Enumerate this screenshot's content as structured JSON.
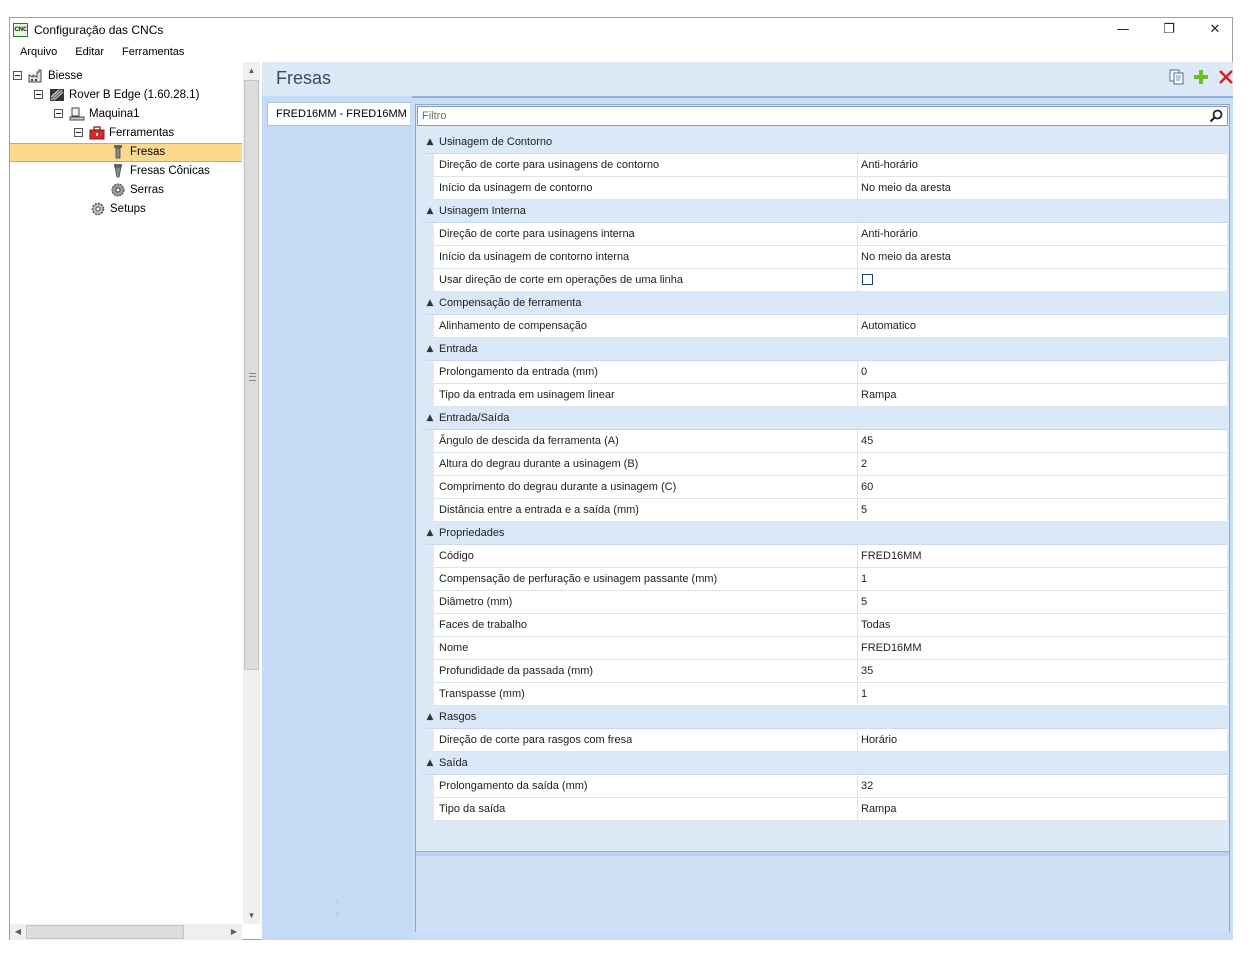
{
  "window": {
    "title": "Configuração das CNCs",
    "app_icon_text": "CNC"
  },
  "window_controls": {
    "minimize": "—",
    "maximize": "❐",
    "close": "✕"
  },
  "menu": [
    "Arquivo",
    "Editar",
    "Ferramentas"
  ],
  "tree": {
    "nodes": [
      {
        "label": "Biesse",
        "icon": "factory-icon"
      },
      {
        "label": "Rover B Edge (1.60.28.1)",
        "icon": "machine-icon"
      },
      {
        "label": "Maquina1",
        "icon": "workstation-icon"
      },
      {
        "label": "Ferramentas",
        "icon": "toolbox-icon"
      },
      {
        "label": "Fresas",
        "icon": "router-bit-icon"
      },
      {
        "label": "Fresas Cônicas",
        "icon": "conical-bit-icon"
      },
      {
        "label": "Serras",
        "icon": "saw-blade-icon"
      },
      {
        "label": "Setups",
        "icon": "gear-icon"
      }
    ],
    "selected": "Fresas"
  },
  "panel": {
    "title": "Fresas",
    "tab_label": "FRED16MM - FRED16MM",
    "filter_placeholder": "Filtro"
  },
  "properties": [
    {
      "category": "Usinagem de Contorno",
      "items": [
        {
          "name": "Direção de corte para usinagens de contorno",
          "value": "Anti-horário"
        },
        {
          "name": "Início da usinagem de contorno",
          "value": "No meio da aresta"
        }
      ]
    },
    {
      "category": "Usinagem Interna",
      "items": [
        {
          "name": "Direção de corte para usinagens interna",
          "value": "Anti-horário"
        },
        {
          "name": "Início da usinagem de contorno interna",
          "value": "No meio da aresta"
        },
        {
          "name": "Usar direção de corte em operações de uma linha",
          "value": "",
          "checkbox": true,
          "checked": false
        }
      ]
    },
    {
      "category": "Compensação de ferramenta",
      "items": [
        {
          "name": "Alinhamento de compensação",
          "value": "Automatico"
        }
      ]
    },
    {
      "category": "Entrada",
      "items": [
        {
          "name": "Prolongamento da entrada (mm)",
          "value": "0"
        },
        {
          "name": "Tipo da entrada em usinagem linear",
          "value": "Rampa"
        }
      ]
    },
    {
      "category": "Entrada/Saída",
      "items": [
        {
          "name": "Ângulo de descida da ferramenta (A)",
          "value": "45"
        },
        {
          "name": "Altura do degrau durante a usinagem (B)",
          "value": "2"
        },
        {
          "name": "Comprimento do degrau durante a usinagem (C)",
          "value": "60"
        },
        {
          "name": "Distância entre a entrada e a saída (mm)",
          "value": "5"
        }
      ]
    },
    {
      "category": "Propriedades",
      "items": [
        {
          "name": "Código",
          "value": "FRED16MM"
        },
        {
          "name": "Compensação de perfuração e usinagem passante (mm)",
          "value": "1"
        },
        {
          "name": "Diâmetro (mm)",
          "value": "5"
        },
        {
          "name": "Faces de trabalho",
          "value": "Todas"
        },
        {
          "name": "Nome",
          "value": "FRED16MM"
        },
        {
          "name": "Profundidade da passada (mm)",
          "value": "35"
        },
        {
          "name": "Transpasse (mm)",
          "value": "1"
        }
      ]
    },
    {
      "category": "Rasgos",
      "items": [
        {
          "name": "Direção de corte para rasgos com fresa",
          "value": "Horário"
        }
      ]
    },
    {
      "category": "Saída",
      "items": [
        {
          "name": "Prolongamento da saída (mm)",
          "value": "32"
        },
        {
          "name": "Tipo da saída",
          "value": "Rampa"
        }
      ]
    }
  ],
  "colors": {
    "accent": "#cfe0f4",
    "selection": "#fcd98c",
    "add": "#6cbf2a",
    "delete": "#e02020"
  }
}
